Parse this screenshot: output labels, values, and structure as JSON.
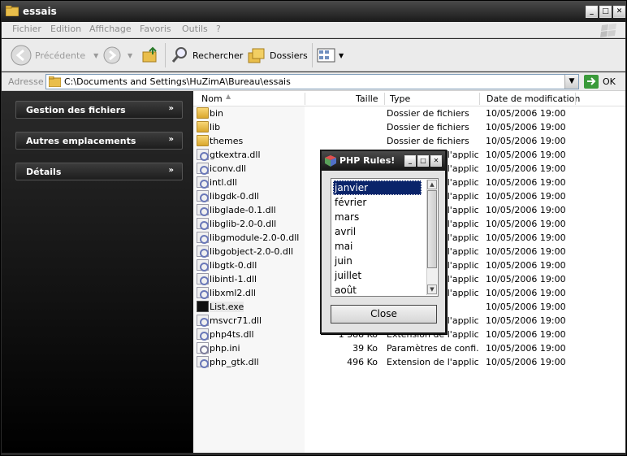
{
  "window": {
    "title": "essais",
    "controls": [
      "minimize",
      "maximize",
      "close"
    ]
  },
  "menubar": {
    "items": [
      "Fichier",
      "Edition",
      "Affichage",
      "Favoris",
      "Outils",
      "?"
    ]
  },
  "toolbar": {
    "back_label": "Précédente",
    "search_label": "Rechercher",
    "folders_label": "Dossiers"
  },
  "address": {
    "label": "Adresse",
    "path": "C:\\Documents and Settings\\HuZimA\\Bureau\\essais",
    "go_label": "OK"
  },
  "taskpane": {
    "groups": [
      "Gestion des fichiers",
      "Autres emplacements",
      "Détails"
    ]
  },
  "filelist": {
    "columns": [
      "Nom",
      "Taille",
      "Type",
      "Date de modification"
    ],
    "rows": [
      {
        "name": "bin",
        "size": "",
        "type": "Dossier de fichiers",
        "date": "10/05/2006 19:00",
        "icon": "folder-icon"
      },
      {
        "name": "lib",
        "size": "",
        "type": "Dossier de fichiers",
        "date": "10/05/2006 19:00",
        "icon": "folder-icon"
      },
      {
        "name": "themes",
        "size": "",
        "type": "Dossier de fichiers",
        "date": "10/05/2006 19:00",
        "icon": "folder-icon"
      },
      {
        "name": "gtkextra.dll",
        "size": "",
        "type": "Extension de l'applic...",
        "date": "10/05/2006 19:00",
        "icon": "dll-icon"
      },
      {
        "name": "iconv.dll",
        "size": "",
        "type": "Extension de l'applic...",
        "date": "10/05/2006 19:00",
        "icon": "dll-icon"
      },
      {
        "name": "intl.dll",
        "size": "",
        "type": "Extension de l'applic...",
        "date": "10/05/2006 19:00",
        "icon": "dll-icon"
      },
      {
        "name": "libgdk-0.dll",
        "size": "",
        "type": "Extension de l'applic...",
        "date": "10/05/2006 19:00",
        "icon": "dll-icon"
      },
      {
        "name": "libglade-0.1.dll",
        "size": "",
        "type": "Extension de l'applic...",
        "date": "10/05/2006 19:00",
        "icon": "dll-icon"
      },
      {
        "name": "libglib-2.0-0.dll",
        "size": "",
        "type": "Extension de l'applic...",
        "date": "10/05/2006 19:00",
        "icon": "dll-icon"
      },
      {
        "name": "libgmodule-2.0-0.dll",
        "size": "",
        "type": "Extension de l'applic...",
        "date": "10/05/2006 19:00",
        "icon": "dll-icon"
      },
      {
        "name": "libgobject-2.0-0.dll",
        "size": "",
        "type": "Extension de l'applic...",
        "date": "10/05/2006 19:00",
        "icon": "dll-icon"
      },
      {
        "name": "libgtk-0.dll",
        "size": "",
        "type": "Extension de l'applic...",
        "date": "10/05/2006 19:00",
        "icon": "dll-icon"
      },
      {
        "name": "libintl-1.dll",
        "size": "",
        "type": "Extension de l'applic...",
        "date": "10/05/2006 19:00",
        "icon": "dll-icon"
      },
      {
        "name": "libxml2.dll",
        "size": "",
        "type": "Extension de l'applic...",
        "date": "10/05/2006 19:00",
        "icon": "dll-icon"
      },
      {
        "name": "List.exe",
        "size": "",
        "type": "",
        "date": "10/05/2006 19:00",
        "icon": "exe-icon"
      },
      {
        "name": "msvcr71.dll",
        "size": "",
        "type": "Extension de l'applic...",
        "date": "10/05/2006 19:00",
        "icon": "dll-icon"
      },
      {
        "name": "php4ts.dll",
        "size": "1 388 Ko",
        "type": "Extension de l'applic...",
        "date": "10/05/2006 19:00",
        "icon": "dll-icon"
      },
      {
        "name": "php.ini",
        "size": "39 Ko",
        "type": "Paramètres de confi...",
        "date": "10/05/2006 19:00",
        "icon": "ini-icon"
      },
      {
        "name": "php_gtk.dll",
        "size": "496 Ko",
        "type": "Extension de l'applic...",
        "date": "10/05/2006 19:00",
        "icon": "dll-icon"
      }
    ]
  },
  "dialog": {
    "title": "PHP Rules!",
    "list_items": [
      "janvier",
      "février",
      "mars",
      "avril",
      "mai",
      "juin",
      "juillet",
      "août"
    ],
    "selected_item": "janvier",
    "close_label": "Close"
  },
  "colors": {
    "selection": "#0a246a",
    "titlebar_dark": "#1a1a1a",
    "taskpane_bg": "#000000"
  }
}
